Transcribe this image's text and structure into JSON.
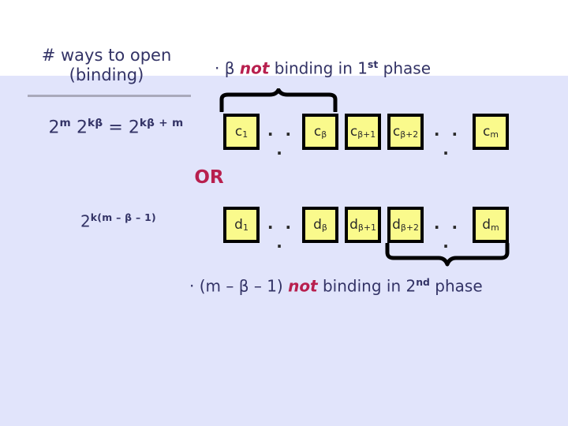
{
  "slide": {
    "background_top": "#ffffff",
    "background_body": "#e1e4fb",
    "text_color": "#333366",
    "accent_color": "#b81f4e",
    "box_fill": "#fafa8c",
    "box_border": "#000000"
  },
  "left_panel": {
    "heading_line1": "# ways to open",
    "heading_line2": "(binding)",
    "formula_binding": {
      "base1": "2",
      "exp1": "m",
      "base2": "2",
      "exp2": "kβ",
      "equals": "=",
      "base3": "2",
      "exp3": "kβ + m"
    },
    "formula_nonbinding": {
      "base": "2",
      "exp": "k(m – β – 1)"
    },
    "or_label": "OR"
  },
  "captions": {
    "top": {
      "prefix": "· β ",
      "emph": "not",
      "middle": " binding in  1",
      "sup": "st",
      "suffix": " phase"
    },
    "bottom": {
      "prefix": "· (m – β – 1) ",
      "emph": "not",
      "middle": " binding in  2",
      "sup": "nd",
      "suffix": " phase"
    }
  },
  "rows": {
    "c_row": {
      "name": "c-sequence",
      "cells": [
        {
          "base": "c",
          "sub": "1"
        },
        {
          "base": "c",
          "sub": "β"
        },
        {
          "base": "c",
          "sub": "β+1"
        },
        {
          "base": "c",
          "sub": "β+2"
        },
        {
          "base": "c",
          "sub": "m"
        }
      ],
      "ellipsis": "· · ·"
    },
    "d_row": {
      "name": "d-sequence",
      "cells": [
        {
          "base": "d",
          "sub": "1"
        },
        {
          "base": "d",
          "sub": "β"
        },
        {
          "base": "d",
          "sub": "β+1"
        },
        {
          "base": "d",
          "sub": "β+2"
        },
        {
          "base": "d",
          "sub": "m"
        }
      ],
      "ellipsis": "· · ·"
    }
  },
  "braces": {
    "top_brace_label": "spans c1 through c-beta",
    "bottom_brace_label": "spans d-beta+2 through d-m"
  }
}
